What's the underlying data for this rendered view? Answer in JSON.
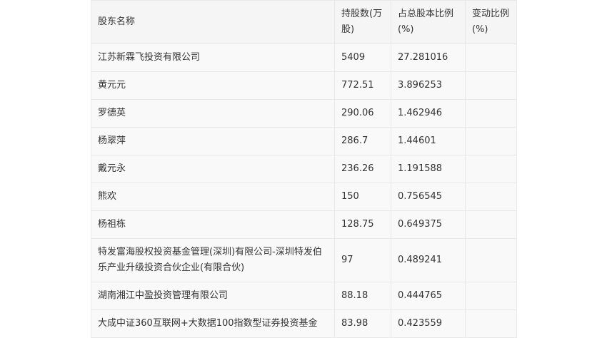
{
  "table": {
    "headers": [
      "股东名称",
      "持股数(万股)",
      "占总股本比例(%)",
      "变动比例(%)"
    ],
    "rows": [
      {
        "name": "江苏新霖飞投资有限公司",
        "shares": "5409",
        "ratio": "27.281016",
        "change": ""
      },
      {
        "name": "黄元元",
        "shares": "772.51",
        "ratio": "3.896253",
        "change": ""
      },
      {
        "name": "罗德英",
        "shares": "290.06",
        "ratio": "1.462946",
        "change": ""
      },
      {
        "name": "杨翠萍",
        "shares": "286.7",
        "ratio": "1.44601",
        "change": ""
      },
      {
        "name": "戴元永",
        "shares": "236.26",
        "ratio": "1.191588",
        "change": ""
      },
      {
        "name": "熊欢",
        "shares": "150",
        "ratio": "0.756545",
        "change": ""
      },
      {
        "name": "杨祖栋",
        "shares": "128.75",
        "ratio": "0.649375",
        "change": ""
      },
      {
        "name": "特发富海股权投资基金管理(深圳)有限公司-深圳特发伯乐产业升级投资合伙企业(有限合伙)",
        "shares": "97",
        "ratio": "0.489241",
        "change": ""
      },
      {
        "name": "湖南湘江中盈投资管理有限公司",
        "shares": "88.18",
        "ratio": "0.444765",
        "change": ""
      },
      {
        "name": "大成中证360互联网+大数据100指数型证券投资基金",
        "shares": "83.98",
        "ratio": "0.423559",
        "change": ""
      }
    ]
  }
}
